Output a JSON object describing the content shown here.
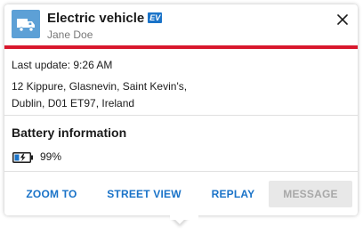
{
  "header": {
    "title": "Electric vehicle",
    "badge": "EV",
    "subtitle": "Jane Doe",
    "vehicle_icon": "truck-icon",
    "close_icon": "close-icon"
  },
  "details": {
    "last_update": "Last update: 9:26 AM",
    "address_line1": "12 Kippure, Glasnevin, Saint Kevin's,",
    "address_line2": "Dublin, D01 ET97, Ireland"
  },
  "battery": {
    "title": "Battery information",
    "icon": "battery-charging-icon",
    "level": "99%"
  },
  "actions": {
    "zoom_to": "ZOOM TO",
    "street_view": "STREET VIEW",
    "replay": "REPLAY",
    "message": "MESSAGE"
  },
  "colors": {
    "accent_red": "#d8182d",
    "link_blue": "#1a73c8",
    "icon_blue": "#5da0d6",
    "disabled_bg": "#e8e8e8"
  }
}
